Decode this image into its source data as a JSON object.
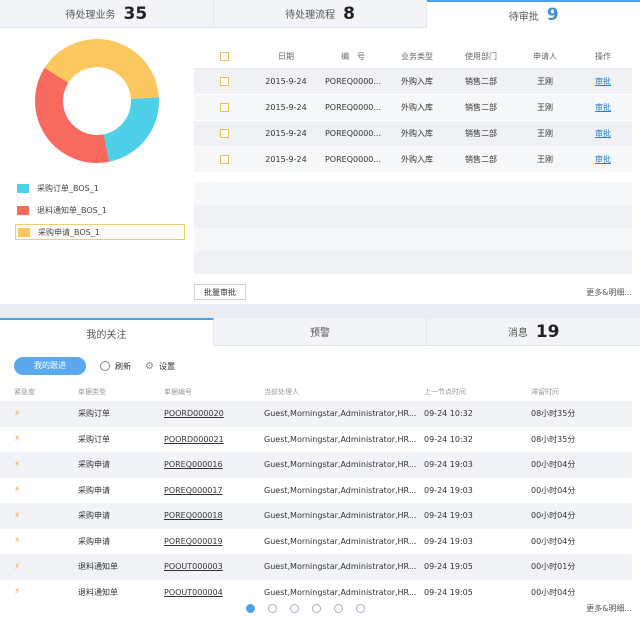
{
  "top_tabs": [
    {
      "label": "待处理业务",
      "count": "35"
    },
    {
      "label": "待处理流程",
      "count": "8"
    },
    {
      "label": "待审批",
      "count": "9"
    }
  ],
  "chart_data": {
    "type": "pie",
    "categories": [
      "采购订单_BOS_1",
      "退料通知单_BOS_1",
      "采购申请_BOS_1"
    ],
    "values": [
      8,
      13,
      14
    ],
    "colors": [
      "#4ed0e8",
      "#f8695f",
      "#fbc85f"
    ],
    "title": "",
    "legend": "bottom"
  },
  "legend": [
    {
      "index": "1",
      "label": "采购订单_BOS_1",
      "color": "#4ed0e8"
    },
    {
      "index": "2",
      "label": "退料通知单_BOS_1",
      "color": "#f8695f"
    },
    {
      "index": "3",
      "label": "采购申请_BOS_1",
      "color": "#fbc85f"
    }
  ],
  "pending": {
    "headers": [
      "日期",
      "编　号",
      "业务类型",
      "使用部门",
      "申请人",
      "操作"
    ],
    "rows": [
      {
        "date": "2015-9-24",
        "no": "POREQ0000...",
        "type": "外购入库",
        "dept": "销售二部",
        "applicant": "王刚",
        "action": "审批"
      },
      {
        "date": "2015-9-24",
        "no": "POREQ0000...",
        "type": "外购入库",
        "dept": "销售二部",
        "applicant": "王刚",
        "action": "审批"
      },
      {
        "date": "2015-9-24",
        "no": "POREQ0000...",
        "type": "外购入库",
        "dept": "销售二部",
        "applicant": "王刚",
        "action": "审批"
      },
      {
        "date": "2015-9-24",
        "no": "POREQ0000...",
        "type": "外购入库",
        "dept": "销售二部",
        "applicant": "王刚",
        "action": "审批"
      }
    ],
    "batch_label": "批量审批",
    "more_label": "更多&明细..."
  },
  "bottom_tabs": [
    {
      "label": "我的关注",
      "count": ""
    },
    {
      "label": "预警",
      "count": ""
    },
    {
      "label": "消息",
      "count": "19"
    }
  ],
  "toolbar": {
    "track_label": "我的跟进",
    "refresh_label": "刷新",
    "settings_label": "设置"
  },
  "follow": {
    "headers": [
      "紧急度",
      "单据类型",
      "单据编号",
      "当前处理人",
      "上一节点时间",
      "滞留时间"
    ],
    "rows": [
      {
        "type": "采购订单",
        "no": "POORD000020",
        "handler": "Guest,Morningstar,Administrator,HR...",
        "time": "09-24 10:32",
        "stay": "08小时35分"
      },
      {
        "type": "采购订单",
        "no": "POORD000021",
        "handler": "Guest,Morningstar,Administrator,HR...",
        "time": "09-24 10:32",
        "stay": "08小时35分"
      },
      {
        "type": "采购申请",
        "no": "POREQ000016",
        "handler": "Guest,Morningstar,Administrator,HR...",
        "time": "09-24 19:03",
        "stay": "00小时04分"
      },
      {
        "type": "采购申请",
        "no": "POREQ000017",
        "handler": "Guest,Morningstar,Administrator,HR...",
        "time": "09-24 19:03",
        "stay": "00小时04分"
      },
      {
        "type": "采购申请",
        "no": "POREQ000018",
        "handler": "Guest,Morningstar,Administrator,HR...",
        "time": "09-24 19:03",
        "stay": "00小时04分"
      },
      {
        "type": "采购申请",
        "no": "POREQ000019",
        "handler": "Guest,Morningstar,Administrator,HR...",
        "time": "09-24 19:03",
        "stay": "00小时04分"
      },
      {
        "type": "退料通知单",
        "no": "POOUT000003",
        "handler": "Guest,Morningstar,Administrator,HR...",
        "time": "09-24 19:05",
        "stay": "00小时01分"
      },
      {
        "type": "退料通知单",
        "no": "POOUT000004",
        "handler": "Guest,Morningstar,Administrator,HR...",
        "time": "09-24 19:05",
        "stay": "00小时04分"
      }
    ],
    "more_label": "更多&明细..."
  },
  "pager": {
    "pages": 6,
    "active": 1
  }
}
